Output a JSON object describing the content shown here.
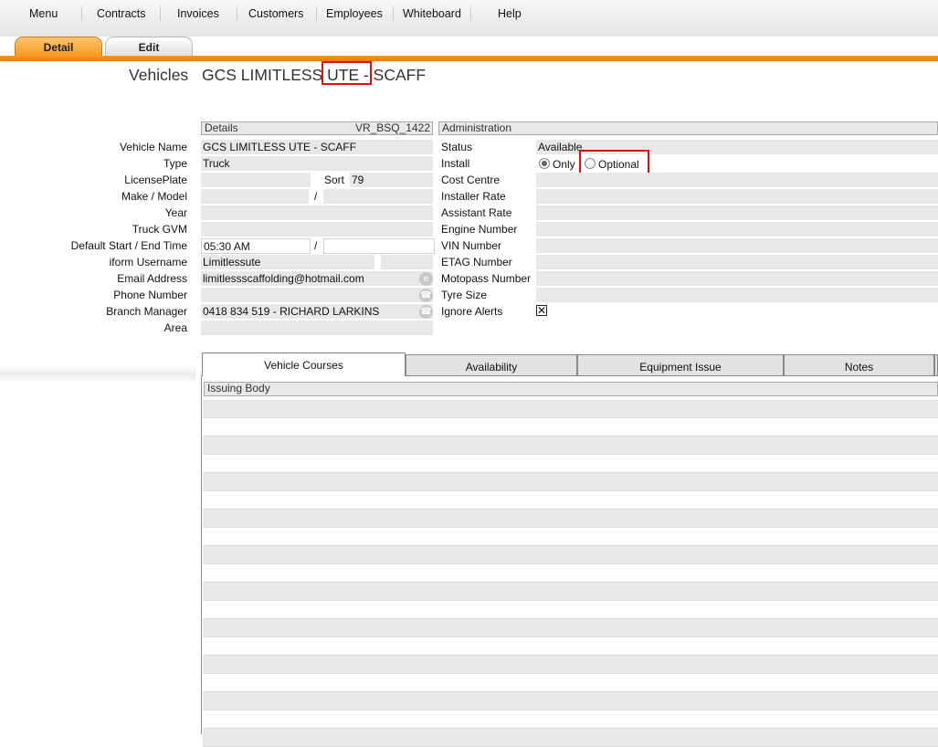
{
  "menu": [
    "Menu",
    "Contracts",
    "Invoices",
    "Customers",
    "Employees",
    "Whiteboard",
    "Help"
  ],
  "tabs": {
    "detail": "Detail",
    "edit": "Edit"
  },
  "heading": {
    "section": "Vehicles",
    "title_pre": "GCS LIMITLESS ",
    "title_highlight": "UTE",
    "title_post": " - SCAFF"
  },
  "details": {
    "header": "Details",
    "code": "VR_BSQ_1422",
    "labels": {
      "vehicle_name": "Vehicle Name",
      "type": "Type",
      "license_plate": "LicensePlate",
      "make_model": "Make / Model",
      "year": "Year",
      "truck_gvm": "Truck GVM",
      "start_end_time": "Default Start / End Time",
      "iform_username": "iform Username",
      "email": "Email Address",
      "phone": "Phone Number",
      "branch_manager": "Branch Manager",
      "area": "Area"
    },
    "values": {
      "vehicle_name": "GCS LIMITLESS UTE - SCAFF",
      "type": "Truck",
      "sort_label": "Sort",
      "sort": "79",
      "slash": "/",
      "start_time": "05:30 AM",
      "iform_username": "Limitlessute",
      "email": "limitlessscaffolding@hotmail.com",
      "branch_manager": "0418 834 519 - RICHARD LARKINS"
    }
  },
  "admin": {
    "header": "Administration",
    "labels": {
      "status": "Status",
      "install": "Install",
      "cost_centre": "Cost Centre",
      "installer_rate": "Installer Rate",
      "assistant_rate": "Assistant Rate",
      "engine_number": "Engine Number",
      "vin": "VIN Number",
      "etag": "ETAG Number",
      "motopass": "Motopass Number",
      "tyre": "Tyre Size",
      "ignore_alerts": "Ignore Alerts"
    },
    "values": {
      "status": "Available",
      "install_only": "Only",
      "install_optional": "Optional"
    }
  },
  "bottom_tabs": [
    "Vehicle Courses",
    "Availability",
    "Equipment Issue",
    "Notes"
  ],
  "grid": {
    "header": "Issuing Body"
  },
  "icons": {
    "email": "email-icon",
    "phone": "phone-icon",
    "branch_phone": "phone-icon"
  }
}
